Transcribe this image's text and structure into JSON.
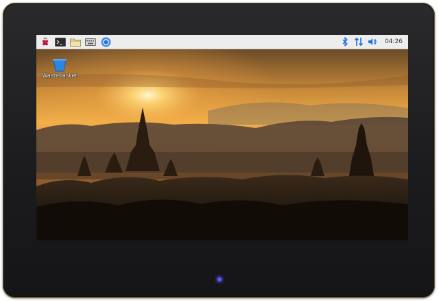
{
  "taskbar": {
    "launchers": [
      {
        "icon": "raspberry-icon"
      },
      {
        "icon": "terminal-icon"
      },
      {
        "icon": "folder-icon"
      },
      {
        "icon": "keyboard-icon"
      },
      {
        "icon": "browser-icon"
      }
    ],
    "tray": {
      "bluetooth_icon": "bluetooth-icon",
      "network_icon": "network-arrows-icon",
      "volume_icon": "volume-icon",
      "clock": "04:26"
    }
  },
  "desktop": {
    "icons": [
      {
        "label": "Wastebasket",
        "icon": "wastebasket-icon"
      }
    ]
  },
  "colors": {
    "taskbar_bg": "#ededed",
    "accent_blue": "#1e6fd9",
    "status_led": "#5b5bff",
    "bezel": "#1b1b1d"
  }
}
